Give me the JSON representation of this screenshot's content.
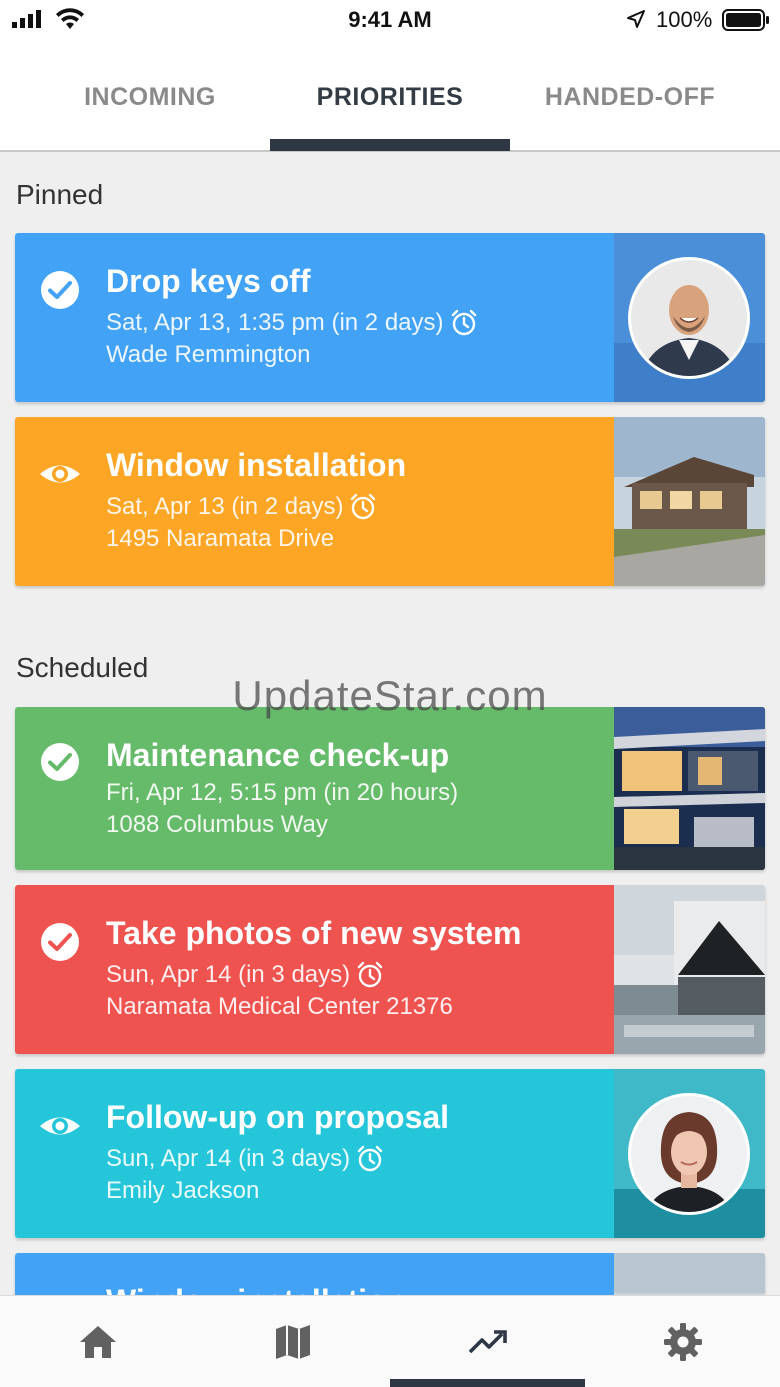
{
  "status_bar": {
    "time": "9:41 AM",
    "battery_percent": "100%",
    "icons": [
      "signal-icon",
      "wifi-icon",
      "location-arrow-icon",
      "battery-icon"
    ]
  },
  "tabs": [
    {
      "label": "INCOMING",
      "active": false
    },
    {
      "label": "PRIORITIES",
      "active": true
    },
    {
      "label": "HANDED-OFF",
      "active": false
    }
  ],
  "sections": {
    "pinned": "Pinned",
    "scheduled": "Scheduled"
  },
  "cards": [
    {
      "title": "Drop keys off",
      "when": "Sat, Apr 13, 1:35 pm (in 2 days)",
      "who": "Wade Remmington",
      "color": "#42a2f5",
      "status_icon": "check-circle-icon",
      "alarm": true,
      "media": "avatar-man"
    },
    {
      "title": "Window installation",
      "when": "Sat, Apr 13 (in 2 days)",
      "who": "1495 Naramata Drive",
      "color": "#fda524",
      "status_icon": "eye-icon",
      "alarm": true,
      "media": "photo-house-hillside"
    },
    {
      "title": "Maintenance check-up",
      "when": "Fri, Apr 12, 5:15 pm (in 20 hours)",
      "who": "1088 Columbus Way",
      "color": "#66bb6a",
      "status_icon": "check-circle-icon",
      "alarm": false,
      "media": "photo-modern-house-night"
    },
    {
      "title": "Take photos of new system",
      "when": "Sun, Apr 14 (in 3 days)",
      "who": "Naramata Medical Center 21376",
      "color": "#ef5350",
      "status_icon": "check-circle-icon",
      "alarm": true,
      "media": "photo-rooftop-hvac"
    },
    {
      "title": "Follow-up on proposal",
      "when": "Sun, Apr 14 (in 3 days)",
      "who": "Emily Jackson",
      "color": "#26c6da",
      "status_icon": "eye-icon",
      "alarm": true,
      "media": "avatar-woman"
    },
    {
      "title": "Window installation",
      "color": "#42a2f5",
      "status_icon": "eye-icon",
      "media": "photo-partial"
    }
  ],
  "watermark": "UpdateStar.com",
  "bottom_nav": [
    {
      "icon": "home-icon",
      "active": false
    },
    {
      "icon": "map-icon",
      "active": false
    },
    {
      "icon": "trending-up-icon",
      "active": true
    },
    {
      "icon": "settings-icon",
      "active": false
    }
  ]
}
